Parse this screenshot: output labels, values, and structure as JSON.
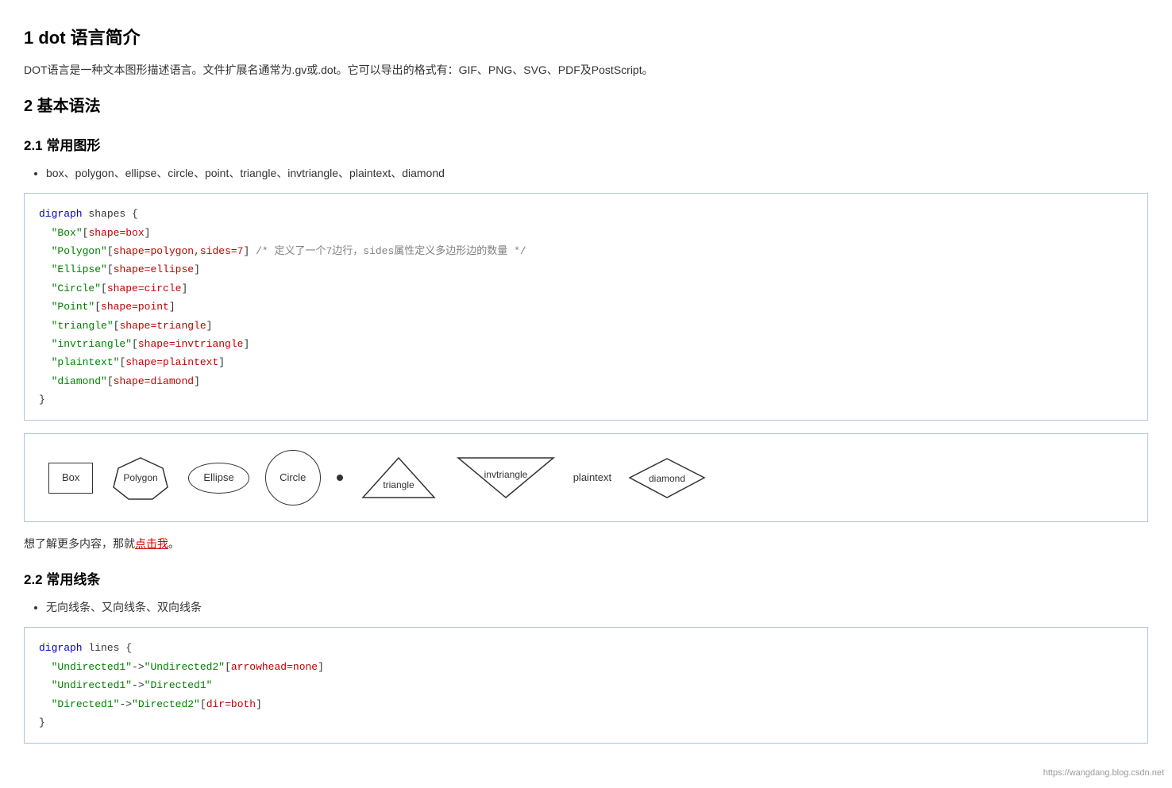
{
  "title1": "1 dot 语言简介",
  "intro": "DOT语言是一种文本图形描述语言。文件扩展名通常为.gv或.dot。它可以导出的格式有：GIF、PNG、SVG、PDF及PostScript。",
  "title2": "2 基本语法",
  "title21": "2.1 常用图形",
  "shapes_list": "box、polygon、ellipse、circle、point、triangle、invtriangle、plaintext、diamond",
  "code_block1_raw": "digraph shapes {\n  \"Box\"[shape=box]\n  \"Polygon\"[shape=polygon,sides=7] /* 定义了一个7边行，sides属性定义多边形边的数量 */\n  \"Ellipse\"[shape=ellipse]\n  \"Circle\"[shape=circle]\n  \"Point\"[shape=point]\n  \"triangle\"[shape=triangle]\n  \"invtriangle\"[shape=invtriangle]\n  \"plaintext\"[shape=plaintext]\n  \"diamond\"[shape=diamond]\n}",
  "diagram_shapes": {
    "box": "Box",
    "polygon": "Polygon",
    "ellipse": "Ellipse",
    "circle": "Circle",
    "triangle": "triangle",
    "invtriangle": "invtriangle",
    "plaintext": "plaintext",
    "diamond": "diamond"
  },
  "more_text": "想了解更多内容，那就",
  "more_link_text": "点击我",
  "more_text2": "。",
  "title22": "2.2 常用线条",
  "lines_list": "无向线条、又向线条、双向线条",
  "code_block2_raw": "digraph lines {\n  \"Undirected1\"->\"Undirected2\"[arrowhead=none]\n  \"Undirected1\"->\"Directed1\"\n  \"Directed1\"->\"Directed2\"[dir=both]\n}",
  "watermark": "https://wangdang.blog.csdn.net"
}
